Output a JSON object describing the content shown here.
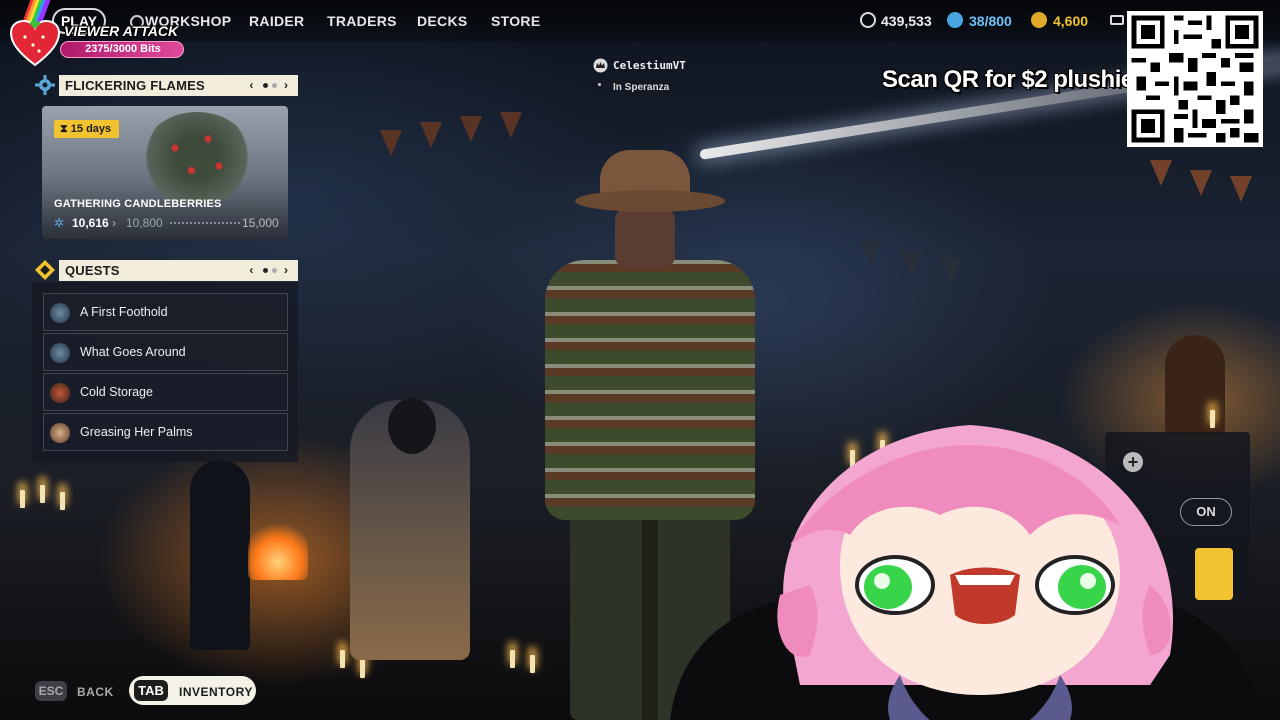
{
  "nav": {
    "play": "PLAY",
    "items": [
      "WORKSHOP",
      "RAIDER",
      "TRADERS",
      "DECKS",
      "STORE"
    ]
  },
  "currencies": {
    "coins": "439,533",
    "tokens": "38/800",
    "credits": "4,600"
  },
  "viewer_attack": {
    "title": "VIEWER ATTACK",
    "bits": "2375/3000 Bits",
    "progress": 0.7917
  },
  "event": {
    "title": "FLICKERING FLAMES",
    "days_badge": "15 days",
    "name": "GATHERING CANDLEBERRIES",
    "current": "10,616",
    "milestone": "10,800",
    "max": "15,000"
  },
  "quests": {
    "title": "QUESTS",
    "items": [
      {
        "label": "A First Foothold",
        "icon": "raider-portrait-icon"
      },
      {
        "label": "What Goes Around",
        "icon": "raider-portrait-icon"
      },
      {
        "label": "Cold Storage",
        "icon": "trader-portrait-icon"
      },
      {
        "label": "Greasing Her Palms",
        "icon": "trader-portrait-icon"
      }
    ]
  },
  "player": {
    "name": "CelestiumVT",
    "location": "In Speranza"
  },
  "stream": {
    "qr_caption": "Scan QR for $2 plushie!"
  },
  "right_panel": {
    "toggle": "ON"
  },
  "bottom": {
    "esc_key": "ESC",
    "back": "BACK",
    "tab_key": "TAB",
    "inventory": "INVENTORY"
  },
  "colors": {
    "accent_yellow": "#f2c230",
    "header_bg": "#f1ecdc",
    "bits_bar": "#e04a9c"
  }
}
